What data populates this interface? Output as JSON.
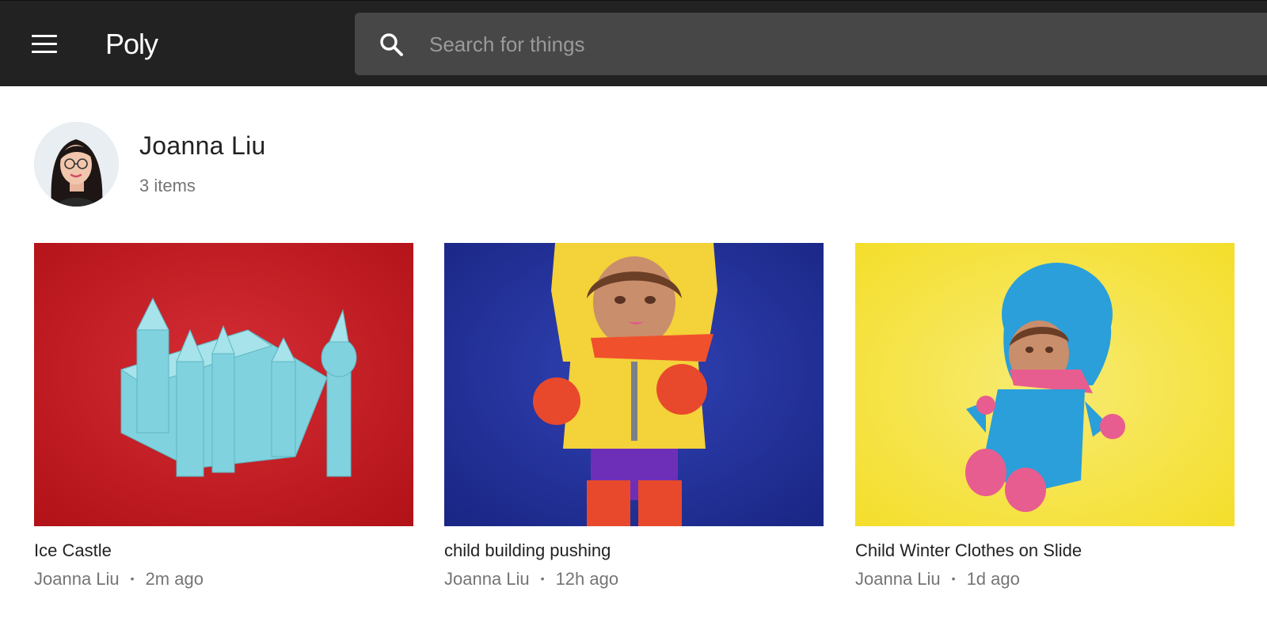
{
  "app": {
    "name": "Poly"
  },
  "search": {
    "placeholder": "Search for things",
    "value": ""
  },
  "profile": {
    "name": "Joanna Liu",
    "item_count": "3 items"
  },
  "items": [
    {
      "title": "Ice Castle",
      "author": "Joanna Liu",
      "age": "2m ago",
      "bg_color": "#c0161b",
      "model_color": "#7fd2de"
    },
    {
      "title": "child building pushing",
      "author": "Joanna Liu",
      "age": "12h ago",
      "bg_color": "#1f2f99",
      "model_color": "#f3d23a"
    },
    {
      "title": "Child Winter Clothes on Slide",
      "author": "Joanna Liu",
      "age": "1d ago",
      "bg_color": "#f7e237",
      "model_color": "#2a9fda"
    }
  ],
  "colors": {
    "topbar": "#222222",
    "search_bg": "#474747",
    "text_primary": "#222222",
    "text_secondary": "#757575"
  }
}
